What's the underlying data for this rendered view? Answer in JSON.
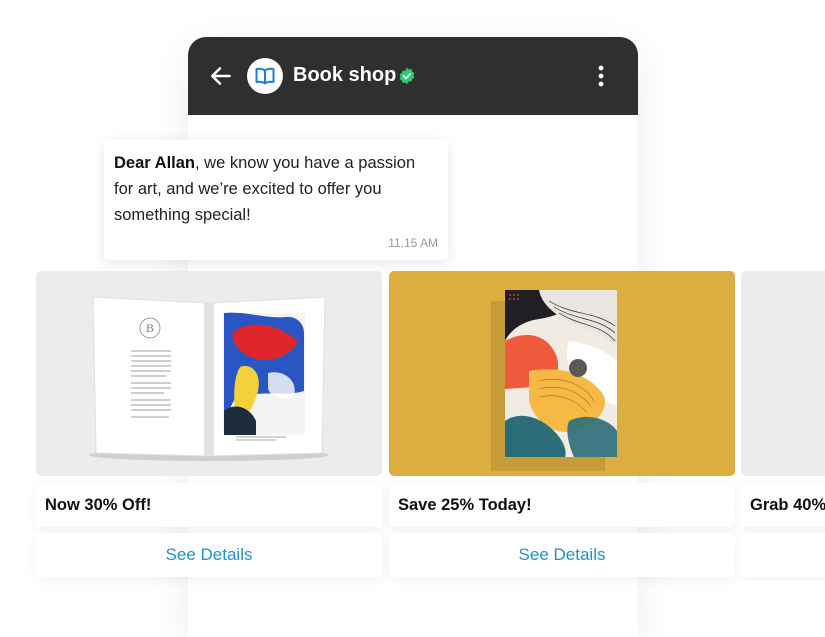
{
  "header": {
    "title": "Book shop"
  },
  "message": {
    "name": "Dear Allan",
    "text": ", we know you have a passion for art, and we’re excited to offer you something special!",
    "time": "11.15 AM"
  },
  "cards": [
    {
      "title": "Now 30% Off!",
      "button": "See Details",
      "image_bg": "#ececec"
    },
    {
      "title": "Save 25% Today!",
      "button": "See Details",
      "image_bg": "#dcae40"
    },
    {
      "title": "Grab 40%",
      "button": "",
      "image_bg": "#ececec"
    }
  ],
  "colors": {
    "header_bg": "#2f2f2f",
    "verified": "#2ecc71",
    "link": "#1e93d1",
    "avatar_icon": "#1e7fd1"
  },
  "icons": {
    "back": "arrow-left-icon",
    "avatar": "open-book-icon",
    "verified": "verified-badge-icon",
    "menu": "more-vertical-icon"
  }
}
